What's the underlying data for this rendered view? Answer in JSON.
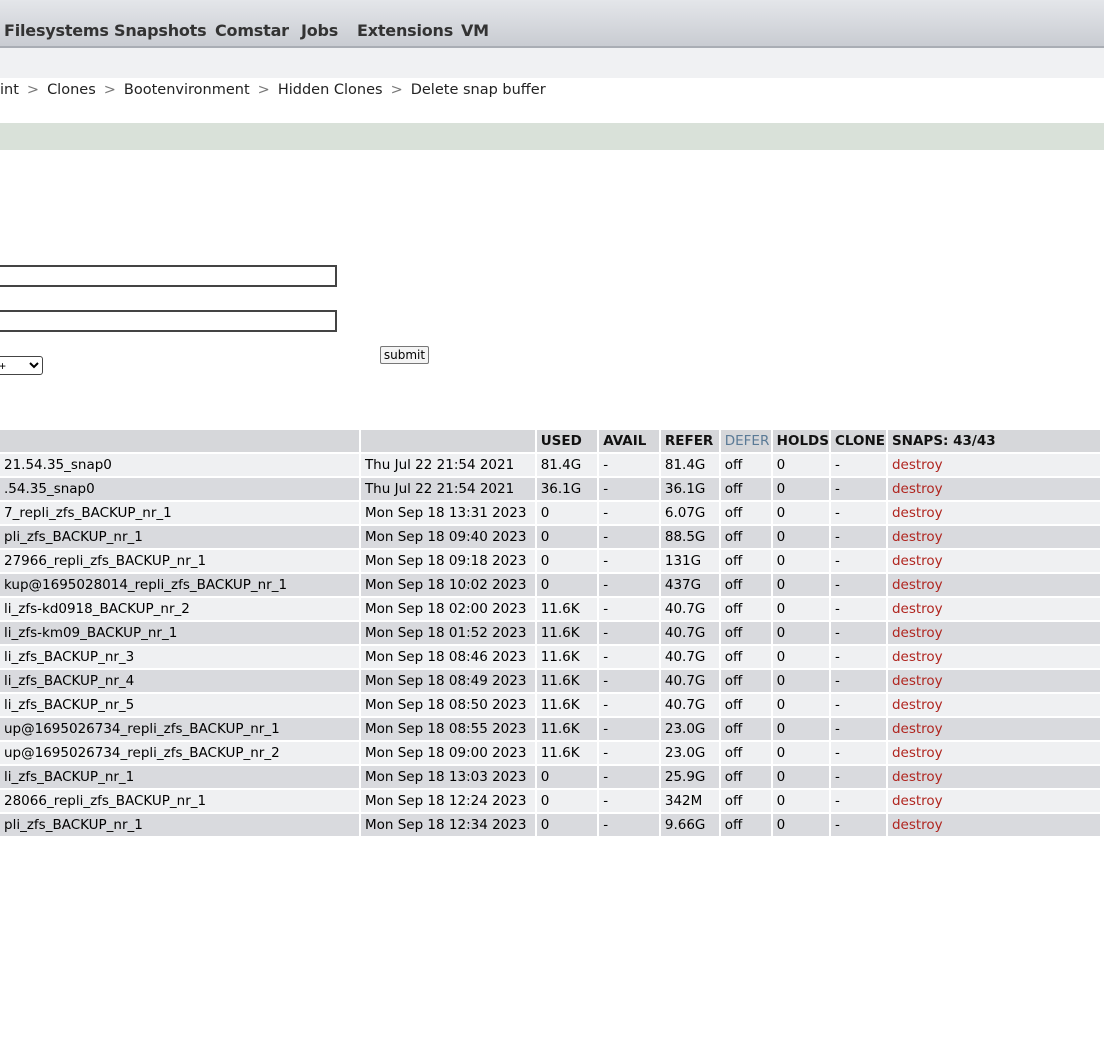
{
  "nav": {
    "items": [
      "Filesystems",
      "Snapshots",
      "Comstar",
      "Jobs",
      "Extensions",
      "VM"
    ]
  },
  "breadcrumb": {
    "items": [
      "int",
      "Clones",
      "Bootenvironment",
      "Hidden Clones",
      "Delete snap buffer"
    ],
    "separator": ">"
  },
  "form": {
    "field1_value": "",
    "field2_value": "",
    "select_value": "+",
    "submit_label": "submit"
  },
  "table": {
    "headers": {
      "name": "",
      "date": "",
      "used": "USED",
      "avail": "AVAIL",
      "refer": "REFER",
      "defer": "DEFER",
      "holds": "HOLDS",
      "clone": "CLONE",
      "snaps": "SNAPS: 43/43"
    },
    "rows": [
      {
        "name": "21.54.35_snap0",
        "date": "Thu Jul 22 21:54 2021",
        "used": "81.4G",
        "avail": "-",
        "refer": "81.4G",
        "defer": "off",
        "holds": "0",
        "clone": "-",
        "action": "destroy"
      },
      {
        "name": ".54.35_snap0",
        "date": "Thu Jul 22 21:54 2021",
        "used": "36.1G",
        "avail": "-",
        "refer": "36.1G",
        "defer": "off",
        "holds": "0",
        "clone": "-",
        "action": "destroy"
      },
      {
        "name": "7_repli_zfs_BACKUP_nr_1",
        "date": "Mon Sep 18 13:31 2023",
        "used": "0",
        "avail": "-",
        "refer": "6.07G",
        "defer": "off",
        "holds": "0",
        "clone": "-",
        "action": "destroy"
      },
      {
        "name": "pli_zfs_BACKUP_nr_1",
        "date": "Mon Sep 18 09:40 2023",
        "used": "0",
        "avail": "-",
        "refer": "88.5G",
        "defer": "off",
        "holds": "0",
        "clone": "-",
        "action": "destroy"
      },
      {
        "name": "27966_repli_zfs_BACKUP_nr_1",
        "date": "Mon Sep 18 09:18 2023",
        "used": "0",
        "avail": "-",
        "refer": "131G",
        "defer": "off",
        "holds": "0",
        "clone": "-",
        "action": "destroy"
      },
      {
        "name": "kup@1695028014_repli_zfs_BACKUP_nr_1",
        "date": "Mon Sep 18 10:02 2023",
        "used": "0",
        "avail": "-",
        "refer": "437G",
        "defer": "off",
        "holds": "0",
        "clone": "-",
        "action": "destroy"
      },
      {
        "name": "li_zfs-kd0918_BACKUP_nr_2",
        "date": "Mon Sep 18 02:00 2023",
        "used": "11.6K",
        "avail": "-",
        "refer": "40.7G",
        "defer": "off",
        "holds": "0",
        "clone": "-",
        "action": "destroy"
      },
      {
        "name": "li_zfs-km09_BACKUP_nr_1",
        "date": "Mon Sep 18 01:52 2023",
        "used": "11.6K",
        "avail": "-",
        "refer": "40.7G",
        "defer": "off",
        "holds": "0",
        "clone": "-",
        "action": "destroy"
      },
      {
        "name": "li_zfs_BACKUP_nr_3",
        "date": "Mon Sep 18 08:46 2023",
        "used": "11.6K",
        "avail": "-",
        "refer": "40.7G",
        "defer": "off",
        "holds": "0",
        "clone": "-",
        "action": "destroy"
      },
      {
        "name": "li_zfs_BACKUP_nr_4",
        "date": "Mon Sep 18 08:49 2023",
        "used": "11.6K",
        "avail": "-",
        "refer": "40.7G",
        "defer": "off",
        "holds": "0",
        "clone": "-",
        "action": "destroy"
      },
      {
        "name": "li_zfs_BACKUP_nr_5",
        "date": "Mon Sep 18 08:50 2023",
        "used": "11.6K",
        "avail": "-",
        "refer": "40.7G",
        "defer": "off",
        "holds": "0",
        "clone": "-",
        "action": "destroy"
      },
      {
        "name": "up@1695026734_repli_zfs_BACKUP_nr_1",
        "date": "Mon Sep 18 08:55 2023",
        "used": "11.6K",
        "avail": "-",
        "refer": "23.0G",
        "defer": "off",
        "holds": "0",
        "clone": "-",
        "action": "destroy"
      },
      {
        "name": "up@1695026734_repli_zfs_BACKUP_nr_2",
        "date": "Mon Sep 18 09:00 2023",
        "used": "11.6K",
        "avail": "-",
        "refer": "23.0G",
        "defer": "off",
        "holds": "0",
        "clone": "-",
        "action": "destroy"
      },
      {
        "name": "li_zfs_BACKUP_nr_1",
        "date": "Mon Sep 18 13:03 2023",
        "used": "0",
        "avail": "-",
        "refer": "25.9G",
        "defer": "off",
        "holds": "0",
        "clone": "-",
        "action": "destroy"
      },
      {
        "name": "28066_repli_zfs_BACKUP_nr_1",
        "date": "Mon Sep 18 12:24 2023",
        "used": "0",
        "avail": "-",
        "refer": "342M",
        "defer": "off",
        "holds": "0",
        "clone": "-",
        "action": "destroy"
      },
      {
        "name": "pli_zfs_BACKUP_nr_1",
        "date": "Mon Sep 18 12:34 2023",
        "used": "0",
        "avail": "-",
        "refer": "9.66G",
        "defer": "off",
        "holds": "0",
        "clone": "-",
        "action": "destroy"
      }
    ]
  }
}
